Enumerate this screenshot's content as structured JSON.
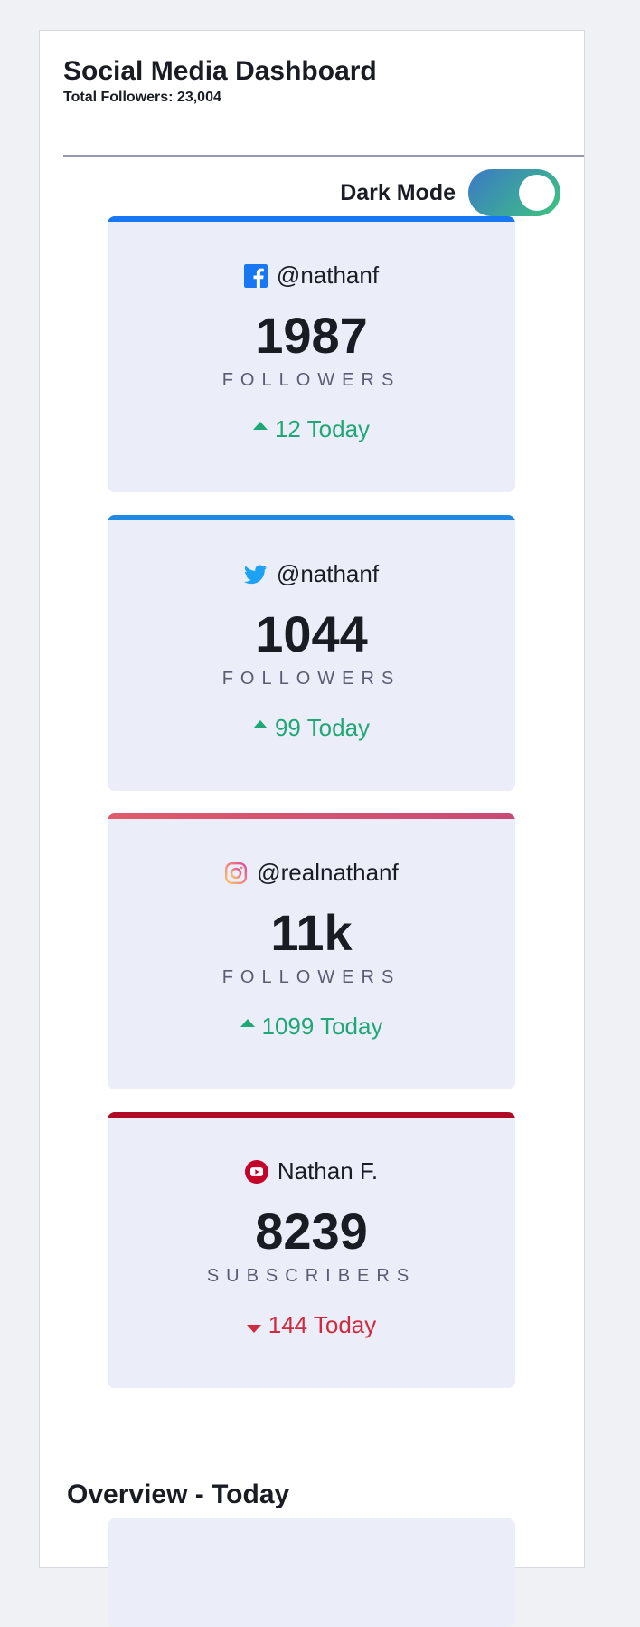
{
  "header": {
    "title": "Social Media Dashboard",
    "total_followers": "Total Followers: 23,004"
  },
  "dark_mode": {
    "label": "Dark Mode",
    "enabled": true
  },
  "cards": [
    {
      "platform_icon": "facebook-icon",
      "handle": "@nathanf",
      "count": "1987",
      "unit": "FOLLOWERS",
      "change": "12 Today",
      "direction": "up",
      "accent": "#1877f2"
    },
    {
      "platform_icon": "twitter-icon",
      "handle": "@nathanf",
      "count": "1044",
      "unit": "FOLLOWERS",
      "change": "99 Today",
      "direction": "up",
      "accent": "#1da1f2"
    },
    {
      "platform_icon": "instagram-icon",
      "handle": "@realnathanf",
      "count": "11k",
      "unit": "FOLLOWERS",
      "change": "1099 Today",
      "direction": "up",
      "accent": "#df4996"
    },
    {
      "platform_icon": "youtube-icon",
      "handle": "Nathan F.",
      "count": "8239",
      "unit": "SUBSCRIBERS",
      "change": "144 Today",
      "direction": "down",
      "accent": "#c4032b"
    }
  ],
  "overview": {
    "title": "Overview - Today"
  }
}
